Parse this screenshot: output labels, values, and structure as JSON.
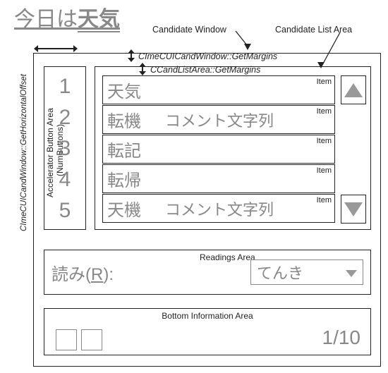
{
  "typed_committed": "今日は",
  "typed_composing": "天気",
  "labels": {
    "candidate_window": "Candidate Window",
    "candidate_list_area": "Candidate List Area",
    "get_margins_window": "CImeCUICandWindow::GetMargins",
    "get_margins_list": "CCandListArea::GetMargins",
    "h_offset": "CImeCUICandWindow::GetHorizontalOffset",
    "accel_btn_area_1": "Accelerator Button Area",
    "accel_btn_area_2": "(NumButtons)",
    "item_tag": "Item",
    "readings_area": "Readings Area",
    "bottom_info_area": "Bottom Information Area"
  },
  "accelerators": [
    "1",
    "2",
    "3",
    "4",
    "5"
  ],
  "items": [
    {
      "text": "天気",
      "comment": ""
    },
    {
      "text": "転機",
      "comment": "コメント文字列"
    },
    {
      "text": "転記",
      "comment": ""
    },
    {
      "text": "転帰",
      "comment": ""
    },
    {
      "text": "天機",
      "comment": "コメント文字列"
    }
  ],
  "readings": {
    "label_prefix": "読み(",
    "label_key": "R",
    "label_suffix": "):",
    "selected": "てんき"
  },
  "pager": "1/10"
}
